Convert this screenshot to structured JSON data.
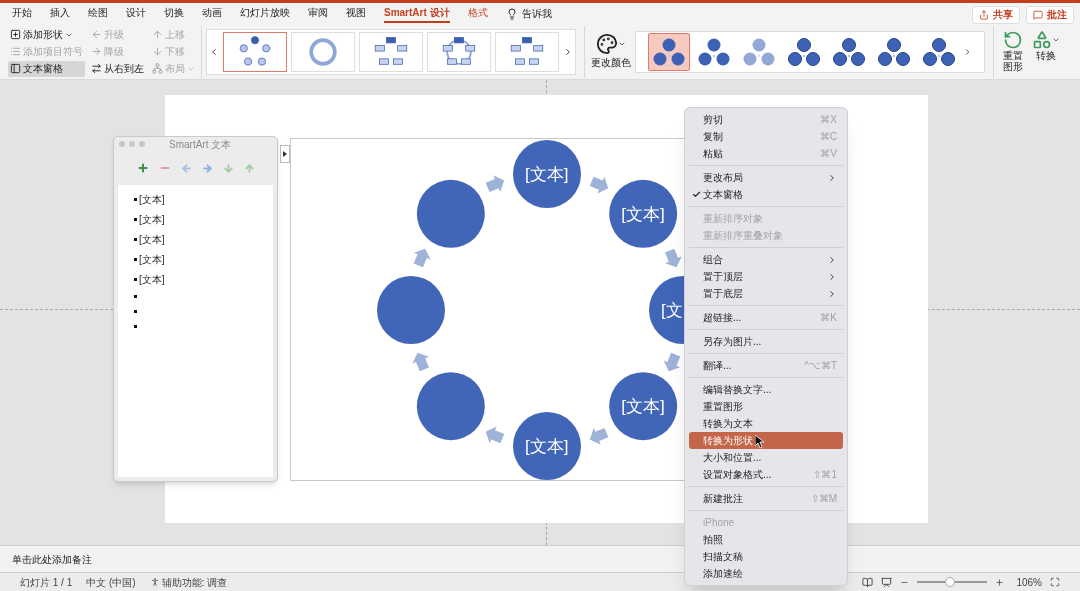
{
  "ribbon_tabs": [
    {
      "label": "开始",
      "kind": "standard",
      "selected": false
    },
    {
      "label": "插入",
      "kind": "standard",
      "selected": false
    },
    {
      "label": "绘图",
      "kind": "standard",
      "selected": false
    },
    {
      "label": "设计",
      "kind": "standard",
      "selected": false
    },
    {
      "label": "切换",
      "kind": "standard",
      "selected": false
    },
    {
      "label": "动画",
      "kind": "standard",
      "selected": false
    },
    {
      "label": "幻灯片放映",
      "kind": "standard",
      "selected": false
    },
    {
      "label": "审阅",
      "kind": "standard",
      "selected": false
    },
    {
      "label": "视图",
      "kind": "standard",
      "selected": false
    },
    {
      "label": "SmartArt 设计",
      "kind": "contextual",
      "selected": true
    },
    {
      "label": "格式",
      "kind": "contextual",
      "selected": false
    }
  ],
  "tell_me": "告诉我",
  "header_buttons": [
    "共享",
    "批注"
  ],
  "ribbon_commands": [
    [
      {
        "label": "添加形状",
        "disabled": false,
        "pressed": false,
        "dropdown": true
      },
      {
        "label": "添加项目符号",
        "disabled": true,
        "pressed": false,
        "dropdown": false
      },
      {
        "label": "文本窗格",
        "disabled": false,
        "pressed": true,
        "dropdown": false
      }
    ],
    [
      {
        "label": "升级",
        "disabled": true,
        "pressed": false,
        "dropdown": false
      },
      {
        "label": "降级",
        "disabled": true,
        "pressed": false,
        "dropdown": false
      },
      {
        "label": "从右到左",
        "disabled": false,
        "pressed": false,
        "dropdown": false
      }
    ],
    [
      {
        "label": "上移",
        "disabled": true,
        "pressed": false,
        "dropdown": false
      },
      {
        "label": "下移",
        "disabled": true,
        "pressed": false,
        "dropdown": false
      },
      {
        "label": "布局",
        "disabled": true,
        "pressed": false,
        "dropdown": true
      }
    ]
  ],
  "layouts": [
    {
      "selected": true
    },
    {
      "selected": false
    },
    {
      "selected": false
    },
    {
      "selected": false
    },
    {
      "selected": false
    }
  ],
  "change_colors": "更改颜色",
  "styles": [
    {
      "selected": true
    },
    {
      "selected": false
    },
    {
      "selected": false
    },
    {
      "selected": false
    },
    {
      "selected": false
    },
    {
      "selected": false
    },
    {
      "selected": false
    }
  ],
  "reset_graphic": "重置图形",
  "convert": "转换",
  "text_pane": {
    "title": "SmartArt 文本",
    "bullets": [
      {
        "kind": "text",
        "text": "[文本]"
      },
      {
        "kind": "text",
        "text": "[文本]"
      },
      {
        "kind": "text",
        "text": "[文本]"
      },
      {
        "kind": "text",
        "text": "[文本]"
      },
      {
        "kind": "text",
        "text": "[文本]"
      },
      {
        "kind": "empty"
      },
      {
        "kind": "empty"
      },
      {
        "kind": "empty"
      }
    ]
  },
  "diagram_nodes": [
    {
      "kind": "labeled",
      "text": "[文本]"
    },
    {
      "kind": "labeled",
      "text": "[文本]"
    },
    {
      "kind": "labeled",
      "text": "[文"
    },
    {
      "kind": "labeled",
      "text": "[文本]"
    },
    {
      "kind": "labeled",
      "text": "[文本]"
    },
    {
      "kind": "blank"
    },
    {
      "kind": "blank"
    },
    {
      "kind": "blank"
    }
  ],
  "context_menu": [
    [
      {
        "label": "剪切",
        "shortcut": "⌘X",
        "kind": "item",
        "disabled": false,
        "checked": false,
        "selected": false
      },
      {
        "label": "复制",
        "shortcut": "⌘C",
        "kind": "item",
        "disabled": false,
        "checked": false,
        "selected": false
      },
      {
        "label": "粘贴",
        "shortcut": "⌘V",
        "kind": "item",
        "disabled": false,
        "checked": false,
        "selected": false
      }
    ],
    [
      {
        "label": "更改布局",
        "kind": "submenu",
        "disabled": false,
        "checked": false,
        "selected": false
      },
      {
        "label": "文本窗格",
        "kind": "item",
        "disabled": false,
        "checked": true,
        "selected": false
      }
    ],
    [
      {
        "label": "重新排序对象",
        "kind": "item",
        "disabled": true,
        "checked": false,
        "selected": false
      },
      {
        "label": "重新排序重叠对象",
        "kind": "item",
        "disabled": true,
        "checked": false,
        "selected": false
      }
    ],
    [
      {
        "label": "组合",
        "kind": "submenu",
        "disabled": false,
        "checked": false,
        "selected": false
      },
      {
        "label": "置于顶层",
        "kind": "submenu",
        "disabled": false,
        "checked": false,
        "selected": false
      },
      {
        "label": "置于底层",
        "kind": "submenu",
        "disabled": false,
        "checked": false,
        "selected": false
      }
    ],
    [
      {
        "label": "超链接...",
        "shortcut": "⌘K",
        "kind": "item",
        "disabled": false,
        "checked": false,
        "selected": false
      }
    ],
    [
      {
        "label": "另存为图片...",
        "kind": "item",
        "disabled": false,
        "checked": false,
        "selected": false
      }
    ],
    [
      {
        "label": "翻译...",
        "shortcut": "^⌥⌘T",
        "kind": "item",
        "disabled": false,
        "checked": false,
        "selected": false
      }
    ],
    [
      {
        "label": "编辑替换文字...",
        "kind": "item",
        "disabled": false,
        "checked": false,
        "selected": false
      },
      {
        "label": "重置图形",
        "kind": "item",
        "disabled": false,
        "checked": false,
        "selected": false
      },
      {
        "label": "转换为文本",
        "kind": "item",
        "disabled": false,
        "checked": false,
        "selected": false
      },
      {
        "label": "转换为形状",
        "kind": "item",
        "disabled": false,
        "checked": false,
        "selected": true
      },
      {
        "label": "大小和位置...",
        "kind": "item",
        "disabled": false,
        "checked": false,
        "selected": false
      },
      {
        "label": "设置对象格式...",
        "shortcut": "⇧⌘1",
        "kind": "item",
        "disabled": false,
        "checked": false,
        "selected": false
      }
    ],
    [
      {
        "label": "新建批注",
        "shortcut": "⇧⌘M",
        "kind": "item",
        "disabled": false,
        "checked": false,
        "selected": false
      }
    ],
    [
      {
        "label": "iPhone",
        "kind": "header",
        "disabled": true,
        "checked": false,
        "selected": false
      },
      {
        "label": "拍照",
        "kind": "item",
        "disabled": false,
        "checked": false,
        "selected": false
      },
      {
        "label": "扫描文稿",
        "kind": "item",
        "disabled": false,
        "checked": false,
        "selected": false
      },
      {
        "label": "添加速绘",
        "kind": "item",
        "disabled": false,
        "checked": false,
        "selected": false
      }
    ]
  ],
  "notes_placeholder": "单击此处添加备注",
  "status_bar": {
    "slide": "幻灯片 1 / 1",
    "language": "中文 (中国)",
    "accessibility": "辅助功能: 调查",
    "zoom": "106%",
    "zoom_slider": {
      "level": 0.47
    }
  }
}
